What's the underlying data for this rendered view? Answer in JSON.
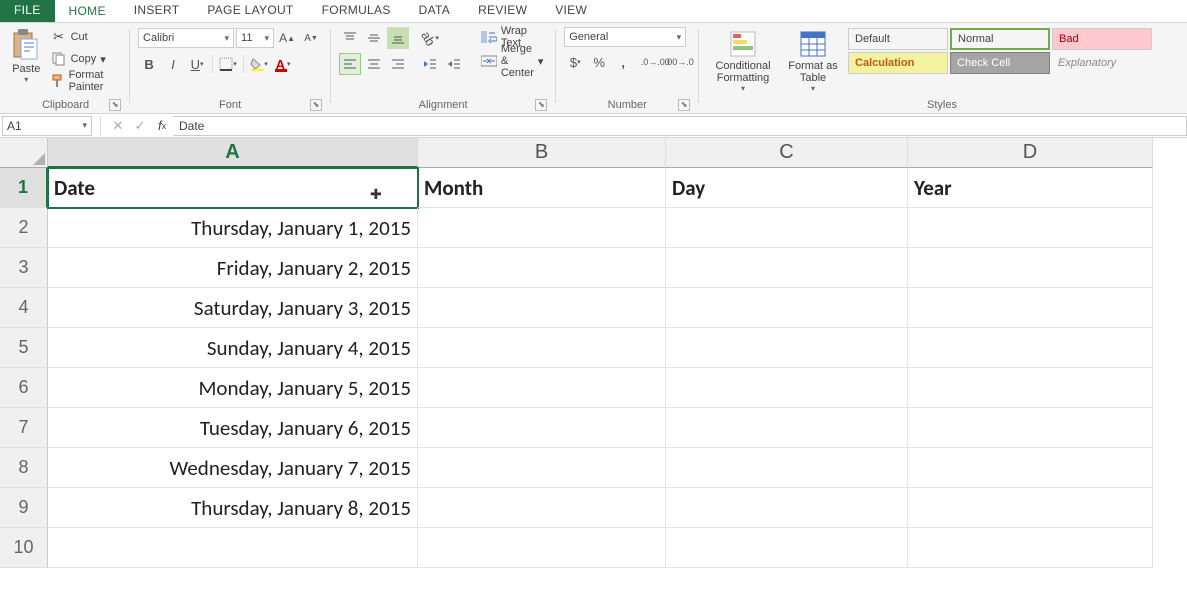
{
  "tabs": [
    "FILE",
    "HOME",
    "INSERT",
    "PAGE LAYOUT",
    "FORMULAS",
    "DATA",
    "REVIEW",
    "VIEW"
  ],
  "active_tab": "HOME",
  "clipboard": {
    "cut": "Cut",
    "copy": "Copy",
    "painter": "Format Painter",
    "paste": "Paste",
    "label": "Clipboard"
  },
  "font": {
    "name": "Calibri",
    "size": "11",
    "label": "Font"
  },
  "alignment": {
    "wrap": "Wrap Text",
    "merge": "Merge & Center",
    "label": "Alignment"
  },
  "number": {
    "format": "General",
    "label": "Number"
  },
  "styles_group": {
    "cond": "Conditional Formatting",
    "table": "Format as Table",
    "label": "Styles",
    "cells": [
      "Default",
      "Normal",
      "Bad",
      "Calculation",
      "Check Cell",
      "Explanatory"
    ]
  },
  "namebox": "A1",
  "formula": "Date",
  "columns": [
    "A",
    "B",
    "C",
    "D"
  ],
  "headers": [
    "Date",
    "Month",
    "Day",
    "Year"
  ],
  "dates": [
    "Thursday, January 1, 2015",
    "Friday, January 2, 2015",
    "Saturday, January 3, 2015",
    "Sunday, January 4, 2015",
    "Monday, January 5, 2015",
    "Tuesday, January 6, 2015",
    "Wednesday, January 7, 2015",
    "Thursday, January 8, 2015"
  ],
  "row_numbers": [
    "1",
    "2",
    "3",
    "4",
    "5",
    "6",
    "7",
    "8",
    "9",
    "10"
  ]
}
